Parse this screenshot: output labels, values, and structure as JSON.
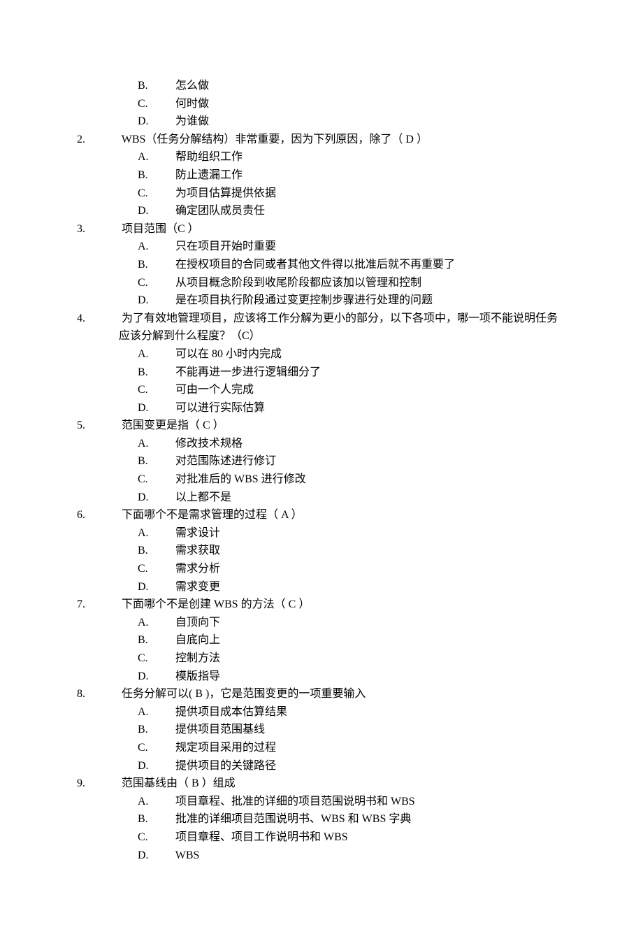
{
  "orphan_options": [
    {
      "letter": "B.",
      "text": "怎么做"
    },
    {
      "letter": "C.",
      "text": "何时做"
    },
    {
      "letter": "D.",
      "text": "为谁做"
    }
  ],
  "questions": [
    {
      "num": "2.",
      "stem": "WBS（任务分解结构）非常重要，因为下列原因，除了（ D ）",
      "options": [
        {
          "letter": "A.",
          "text": "帮助组织工作"
        },
        {
          "letter": "B.",
          "text": "防止遗漏工作"
        },
        {
          "letter": "C.",
          "text": "为项目估算提供依据"
        },
        {
          "letter": "D.",
          "text": "确定团队成员责任"
        }
      ]
    },
    {
      "num": "3.",
      "stem": "项目范围（C ）",
      "options": [
        {
          "letter": "A.",
          "text": "只在项目开始时重要"
        },
        {
          "letter": "B.",
          "text": "在授权项目的合同或者其他文件得以批准后就不再重要了"
        },
        {
          "letter": "C.",
          "text": "从项目概念阶段到收尾阶段都应该加以管理和控制"
        },
        {
          "letter": "D.",
          "text": "是在项目执行阶段通过变更控制步骤进行处理的问题"
        }
      ]
    },
    {
      "num": "4.",
      "stem": "为了有效地管理项目，应该将工作分解为更小的部分，以下各项中，哪一项不能说明任务应该分解到什么程度？（C）",
      "options": [
        {
          "letter": "A.",
          "text": "可以在 80 小时内完成"
        },
        {
          "letter": "B.",
          "text": "不能再进一步进行逻辑细分了"
        },
        {
          "letter": "C.",
          "text": "可由一个人完成"
        },
        {
          "letter": "D.",
          "text": "可以进行实际估算"
        }
      ]
    },
    {
      "num": "5.",
      "stem": "范围变更是指（ C ）",
      "options": [
        {
          "letter": "A.",
          "text": "修改技术规格"
        },
        {
          "letter": "B.",
          "text": "对范围陈述进行修订"
        },
        {
          "letter": "C.",
          "text": "对批准后的 WBS 进行修改"
        },
        {
          "letter": "D.",
          "text": "以上都不是"
        }
      ]
    },
    {
      "num": "6.",
      "stem": "下面哪个不是需求管理的过程（ A  ）",
      "options": [
        {
          "letter": "A.",
          "text": "需求设计"
        },
        {
          "letter": "B.",
          "text": "需求获取"
        },
        {
          "letter": "C.",
          "text": "需求分析"
        },
        {
          "letter": "D.",
          "text": "需求变更"
        }
      ]
    },
    {
      "num": "7.",
      "stem": "下面哪个不是创建 WBS 的方法（ C ）",
      "options": [
        {
          "letter": "A.",
          "text": "自顶向下"
        },
        {
          "letter": "B.",
          "text": "自底向上"
        },
        {
          "letter": "C.",
          "text": "控制方法"
        },
        {
          "letter": "D.",
          "text": "模版指导"
        }
      ]
    },
    {
      "num": "8.",
      "stem": "任务分解可以(      B   )，它是范围变更的一项重要输入",
      "options": [
        {
          "letter": "A.",
          "text": "提供项目成本估算结果"
        },
        {
          "letter": "B.",
          "text": "提供项目范围基线"
        },
        {
          "letter": "C.",
          "text": "规定项目采用的过程"
        },
        {
          "letter": "D.",
          "text": "提供项目的关键路径"
        }
      ]
    },
    {
      "num": "9.",
      "stem": "范围基线由（ B  ）组成",
      "options": [
        {
          "letter": "A.",
          "text": "项目章程、批准的详细的项目范围说明书和 WBS"
        },
        {
          "letter": "B.",
          "text": "批准的详细项目范围说明书、WBS 和 WBS 字典"
        },
        {
          "letter": "C.",
          "text": "项目章程、项目工作说明书和 WBS"
        },
        {
          "letter": "D.",
          "text": "WBS"
        }
      ]
    }
  ]
}
